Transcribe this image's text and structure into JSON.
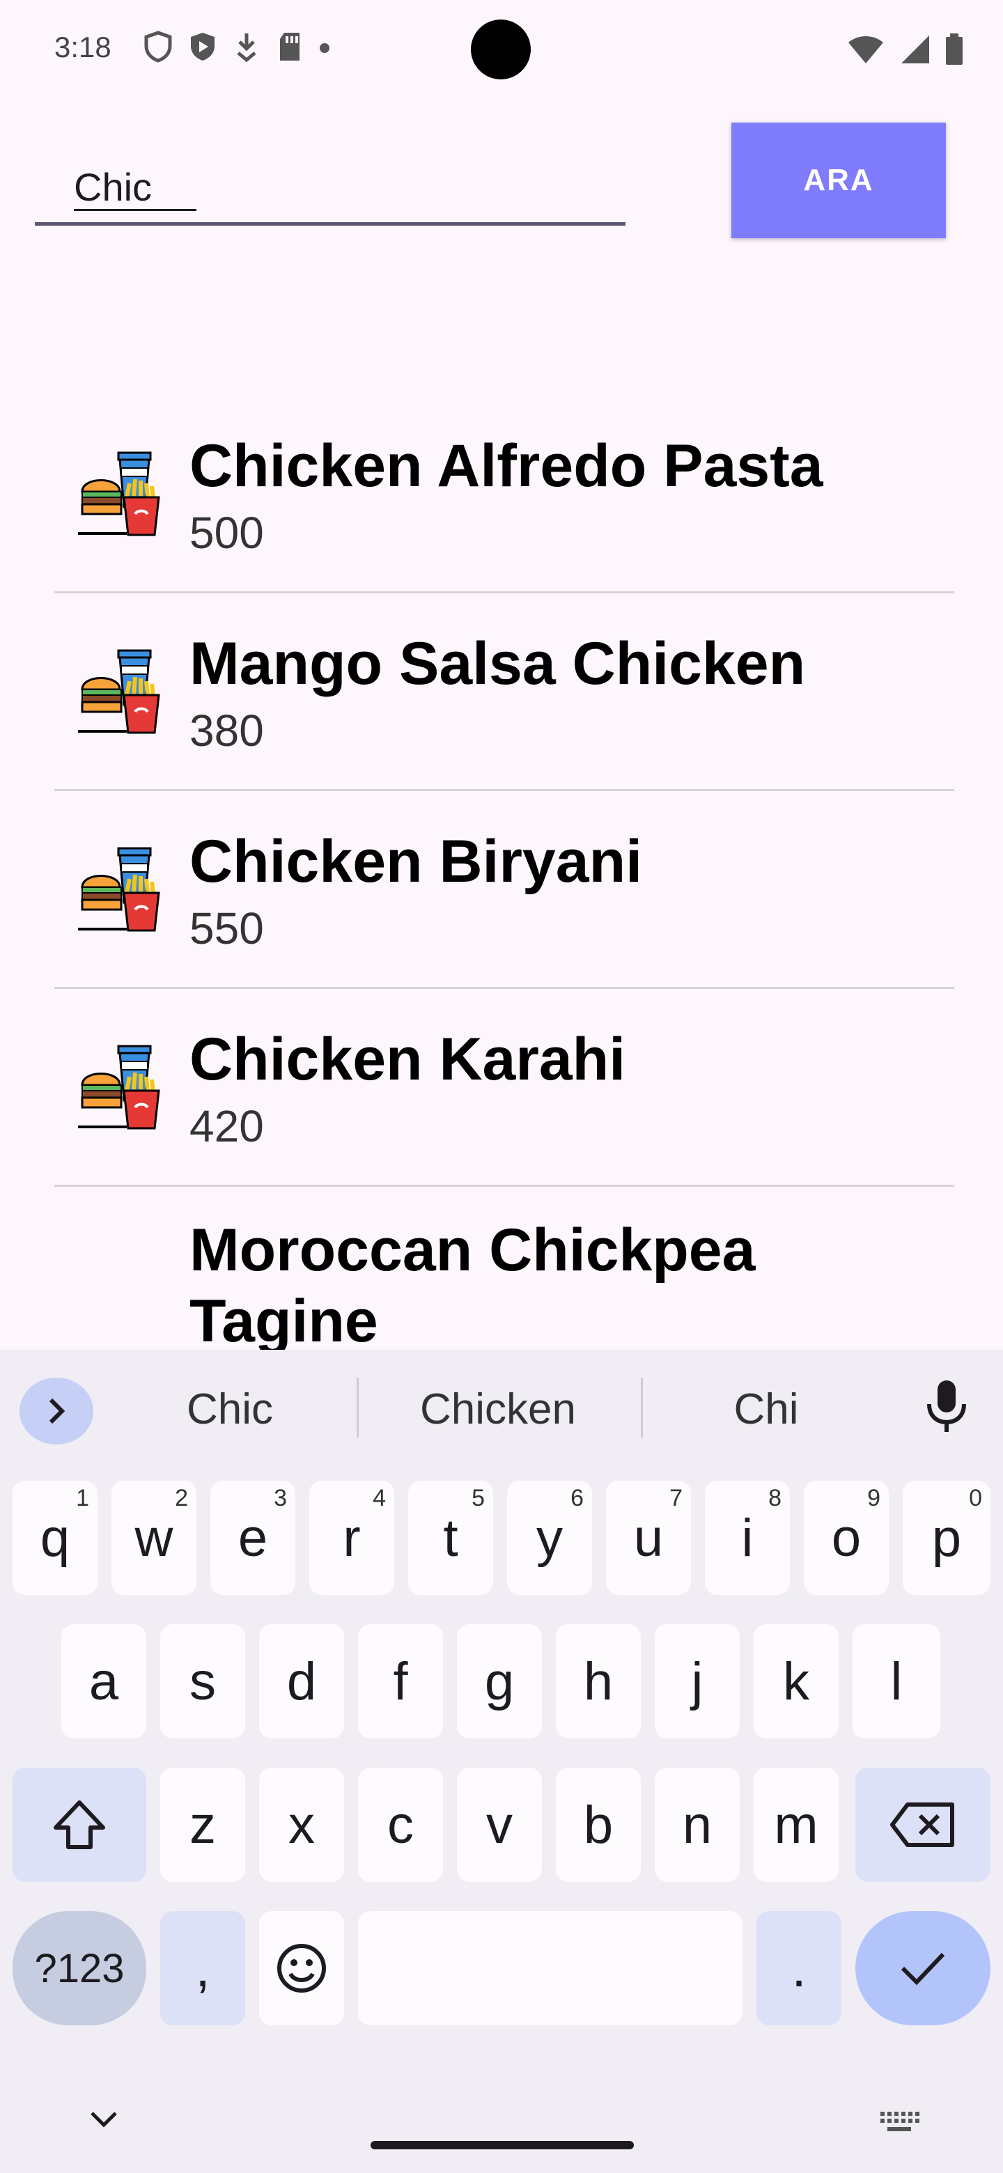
{
  "status_bar": {
    "time": "3:18"
  },
  "search": {
    "value": "Chic",
    "button_label": "ARA"
  },
  "foods": [
    {
      "name": "Chicken Alfredo Pasta",
      "calories": "500"
    },
    {
      "name": "Mango Salsa Chicken",
      "calories": "380"
    },
    {
      "name": "Chicken Biryani",
      "calories": "550"
    },
    {
      "name": "Chicken Karahi",
      "calories": "420"
    },
    {
      "name": "Moroccan Chickpea Tagine",
      "calories": ""
    }
  ],
  "keyboard": {
    "suggestions": [
      "Chic",
      "Chicken",
      "Chi"
    ],
    "row1": [
      "q",
      "w",
      "e",
      "r",
      "t",
      "y",
      "u",
      "i",
      "o",
      "p"
    ],
    "row1_hints": [
      "1",
      "2",
      "3",
      "4",
      "5",
      "6",
      "7",
      "8",
      "9",
      "0"
    ],
    "row2": [
      "a",
      "s",
      "d",
      "f",
      "g",
      "h",
      "j",
      "k",
      "l"
    ],
    "row3": [
      "z",
      "x",
      "c",
      "v",
      "b",
      "n",
      "m"
    ],
    "symbols_label": "?123",
    "comma": ",",
    "period": "."
  },
  "colors": {
    "accent": "#7f7cfe",
    "background": "#fdf7fd",
    "keyboard_bg": "#f0edf4"
  }
}
